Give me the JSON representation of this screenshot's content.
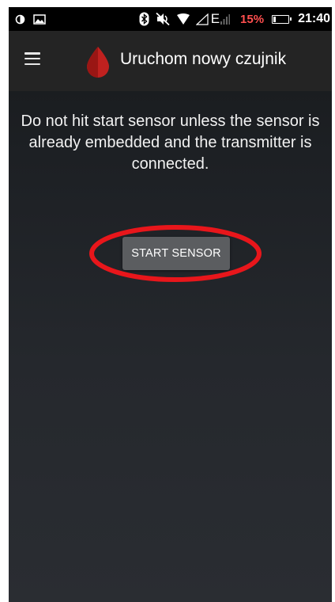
{
  "status_bar": {
    "time": "21:40",
    "battery_percent": "15%",
    "network_label": "E",
    "icons": [
      "half-circle-icon",
      "image-icon",
      "bluetooth-icon",
      "mute-icon",
      "wifi-icon",
      "signal-icon",
      "battery-icon"
    ],
    "battery_color": "#ff4f4f"
  },
  "app_bar": {
    "title": "Uruchom nowy czujnik",
    "menu_icon": "menu-icon",
    "logo_icon": "blood-drop-icon",
    "logo_color": "#c0211f"
  },
  "main": {
    "message": "Do not hit start sensor unless the sensor is already embedded and the transmitter is connected.",
    "start_button_label": "START SENSOR",
    "highlight_color": "#e8161b"
  }
}
